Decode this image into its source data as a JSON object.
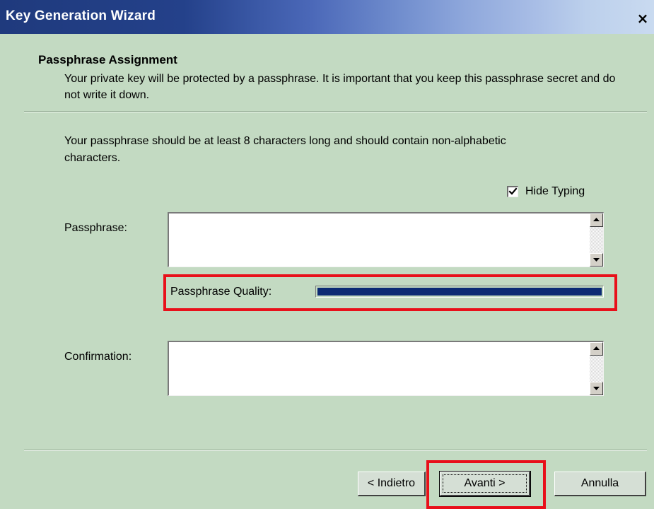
{
  "window": {
    "title": "Key Generation Wizard",
    "close_glyph": "×"
  },
  "header": {
    "title": "Passphrase Assignment",
    "description": "Your private key will be protected by a passphrase.  It is important that you keep this passphrase secret and do not write it down."
  },
  "body": {
    "instructions": "Your passphrase should be at least 8 characters long and should contain non-alphabetic characters."
  },
  "hide_typing": {
    "label": "Hide Typing",
    "checked": true
  },
  "passphrase": {
    "label": "Passphrase:",
    "value": ""
  },
  "quality": {
    "label": "Passphrase Quality:",
    "level": 1.0
  },
  "confirmation": {
    "label": "Confirmation:",
    "value": ""
  },
  "buttons": {
    "back": "< Indietro",
    "next": "Avanti >",
    "cancel": "Annulla"
  },
  "colors": {
    "dialog_bg": "#c3dac2",
    "title_bar_start": "#1f3a7d",
    "title_bar_end": "#c9daf0",
    "quality_fill": "#0c2a73",
    "annotation_red": "#e8101a"
  }
}
